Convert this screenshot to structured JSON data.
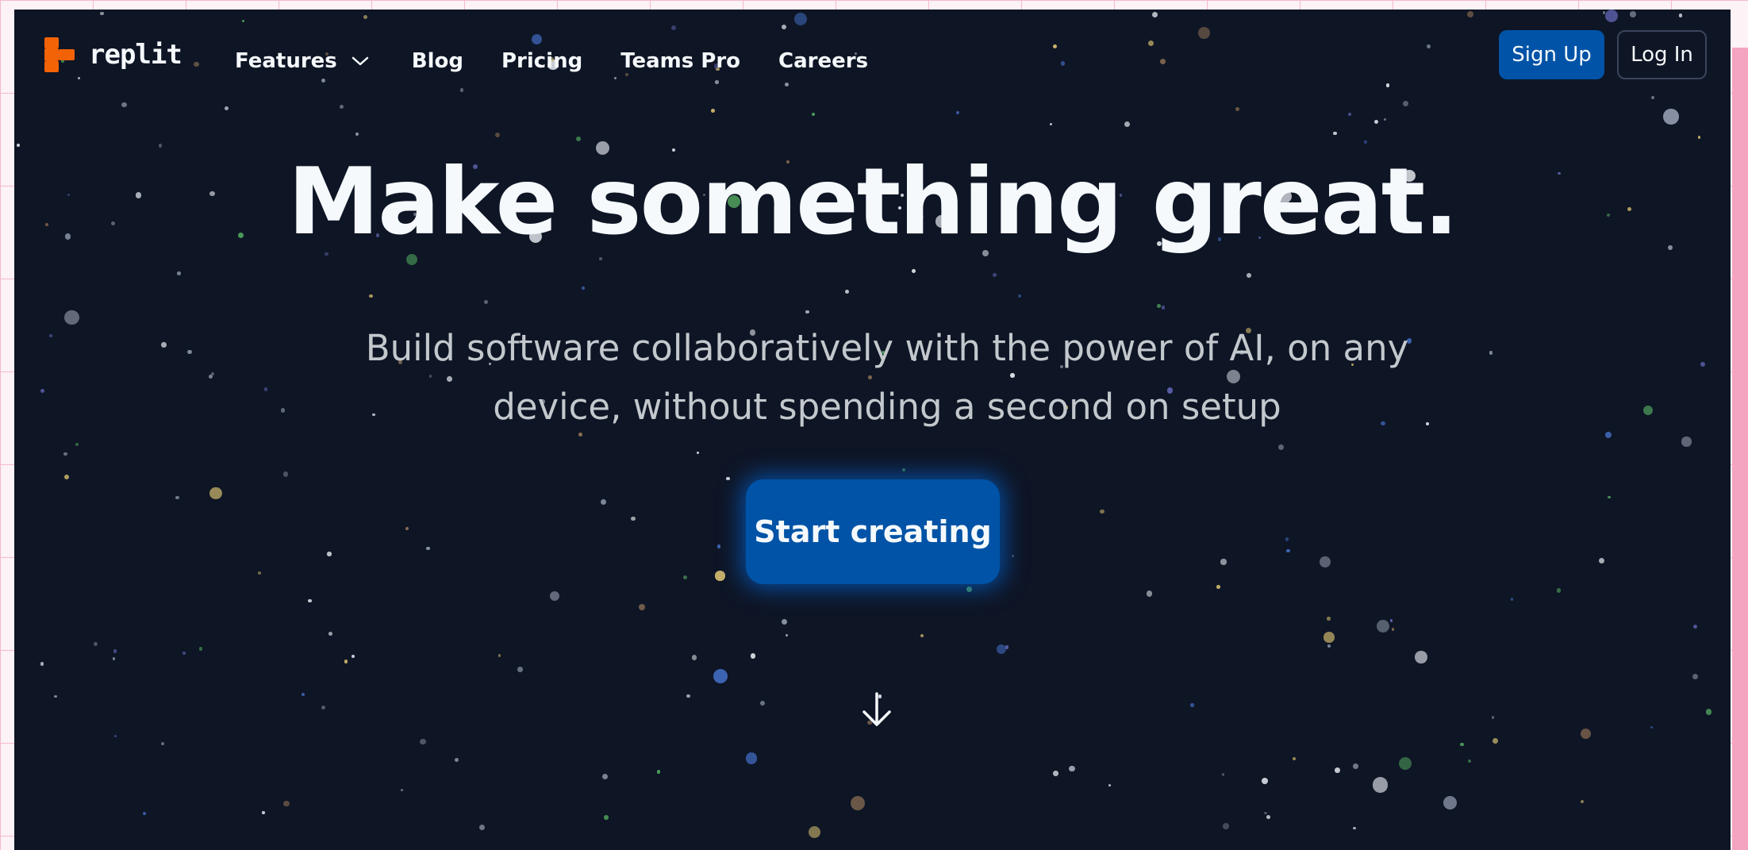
{
  "brand": {
    "name": "replit",
    "accent": "#f26207"
  },
  "nav": {
    "items": [
      {
        "label": "Features",
        "has_dropdown": true
      },
      {
        "label": "Blog"
      },
      {
        "label": "Pricing"
      },
      {
        "label": "Teams Pro"
      },
      {
        "label": "Careers"
      }
    ],
    "signup_label": "Sign Up",
    "login_label": "Log In"
  },
  "hero": {
    "title": "Make something great.",
    "subtitle_line1": "Build software collaboratively with the power of AI, on any",
    "subtitle_line2": "device, without spending a second on setup",
    "cta_label": "Start creating",
    "scroll_icon": "arrow-down-icon"
  },
  "colors": {
    "background": "#0e1525",
    "primary_button": "#0053a6",
    "text": "#f5f9fc",
    "subtext": "#c2c8cc"
  }
}
